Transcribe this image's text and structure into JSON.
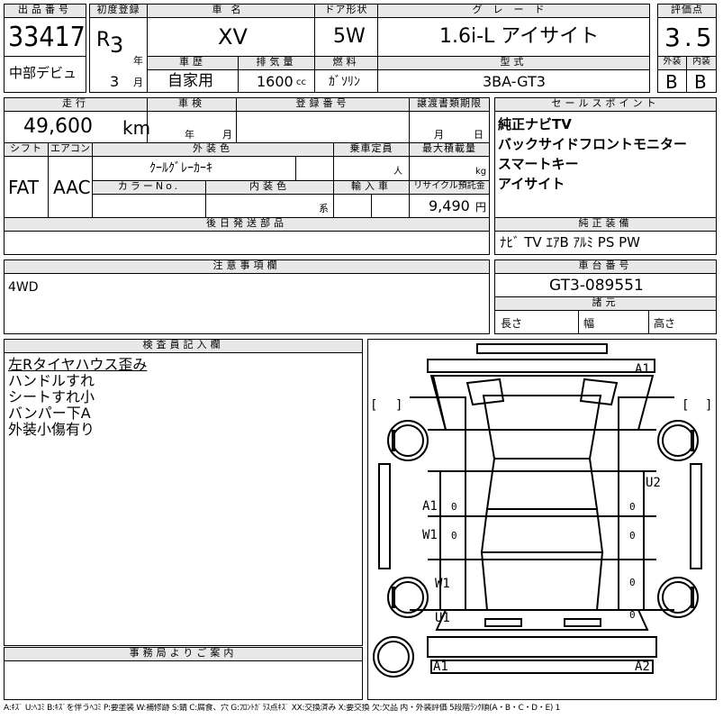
{
  "headers": {
    "lot_no": "出品番号",
    "first_reg": "初度登録",
    "car_name": "車名",
    "door": "ドア形状",
    "grade": "グレード",
    "score": "評価点",
    "history": "車歴",
    "displacement": "排気量",
    "fuel": "燃料",
    "model": "型式",
    "exterior": "外装",
    "interior": "内装",
    "mileage": "走行",
    "inspection": "車検",
    "reg_no": "登録番号",
    "transfer_docs": "譲渡書類期限",
    "selling_points": "セールスポイント",
    "shift": "シフト",
    "aircon": "エアコン",
    "ext_color": "外装色",
    "capacity": "乗車定員",
    "max_load": "最大積載量",
    "color_no": "カラーNo.",
    "int_color": "内装色",
    "import": "輸入車",
    "recycle": "リサイクル預託金",
    "deferred_parts": "後日発送部品",
    "genuine_equip": "純正装備",
    "notes": "注意事項欄",
    "chassis_no": "車台番号",
    "specs": "諸元",
    "inspector": "検査員記入欄",
    "office": "事務局よりご案内"
  },
  "units": {
    "year": "年",
    "month": "月",
    "cc": "cc",
    "km": "km",
    "person": "人",
    "kg": "kg",
    "yen": "円",
    "kei": "系",
    "day": "日",
    "length": "長さ",
    "width": "幅",
    "height": "高さ"
  },
  "vehicle": {
    "lot_no": "33417",
    "event": "中部デビュ",
    "era": "R",
    "year": "3",
    "month": "3",
    "car_name": "XV",
    "door": "5W",
    "grade": "1.6i-L アイサイト",
    "score": "3.5",
    "ext_score": "B",
    "int_score": "B",
    "history": "自家用",
    "displacement": "1600",
    "fuel": "ｶﾞｿﾘﾝ",
    "model": "3BA-GT3",
    "mileage": "49,600",
    "shift": "FAT",
    "aircon": "AAC",
    "color": "ｸｰﾙｸﾞﾚｰｶｰｷ",
    "recycle": "9,490",
    "chassis_no": "GT3-089551",
    "notes": "4WD",
    "equipment": "ﾅﾋﾞ TV ｴｱB ｱﾙﾐ PS PW"
  },
  "selling_points": [
    "純正ナビTV",
    "バックサイドフロントモニター",
    "スマートキー",
    "アイサイト"
  ],
  "inspector_notes": [
    "左Rタイヤハウス歪み",
    "ハンドルすれ",
    "シートすれ小",
    "バンパー下A",
    "外装小傷有り"
  ],
  "diagram": {
    "labels": [
      "A1",
      "U2",
      "A1",
      "W1",
      "W1",
      "U1",
      "A1",
      "A2"
    ],
    "zeros": [
      "0",
      "0",
      "0",
      "0",
      "0",
      "0"
    ],
    "brackets": [
      "[",
      "]",
      "[",
      "]"
    ]
  },
  "legend": "A:ｷｽﾞ U:ﾍｺﾐ B:ｷｽﾞを伴うﾍｺﾐ P:要塗装 W:補修跡 S:錆 C:腐食、穴 G:ﾌﾛﾝﾄｶﾞﾗｽ点ｷｽﾞ XX:交換済み X:要交換 欠:欠品 内・外装評価 5段階ﾗﾝｸ順(A・B・C・D・E) 1"
}
